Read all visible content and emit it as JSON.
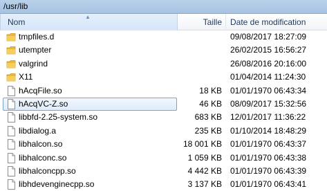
{
  "window": {
    "title": "/usr/lib"
  },
  "columns": {
    "name": "Nom",
    "size": "Taille",
    "date": "Date de modification"
  },
  "colors": {
    "folder": "#e8b83a",
    "selection_border": "#7da2ce",
    "header_text": "#1e395b"
  },
  "files": [
    {
      "name": "tmpfiles.d",
      "size": "",
      "date": "09/08/2017 18:27:09",
      "icon": "folder-icon",
      "selected": false
    },
    {
      "name": "utempter",
      "size": "",
      "date": "26/02/2015 16:56:27",
      "icon": "folder-icon",
      "selected": false
    },
    {
      "name": "valgrind",
      "size": "",
      "date": "26/08/2016 20:16:00",
      "icon": "folder-icon",
      "selected": false
    },
    {
      "name": "X11",
      "size": "",
      "date": "01/04/2014 11:24:30",
      "icon": "folder-icon",
      "selected": false
    },
    {
      "name": "hAcqFile.so",
      "size": "18 KB",
      "date": "01/01/1970 06:43:34",
      "icon": "file-icon",
      "selected": false
    },
    {
      "name": "hAcqVC-Z.so",
      "size": "46 KB",
      "date": "08/09/2017 15:32:56",
      "icon": "file-icon",
      "selected": true
    },
    {
      "name": "libbfd-2.25-system.so",
      "size": "683 KB",
      "date": "12/01/2017 11:36:22",
      "icon": "file-icon",
      "selected": false
    },
    {
      "name": "libdialog.a",
      "size": "235 KB",
      "date": "01/10/2014 18:48:29",
      "icon": "file-icon",
      "selected": false
    },
    {
      "name": "libhalcon.so",
      "size": "18 001 KB",
      "date": "01/01/1970 06:43:37",
      "icon": "file-icon",
      "selected": false
    },
    {
      "name": "libhalconc.so",
      "size": "1 059 KB",
      "date": "01/01/1970 06:43:38",
      "icon": "file-icon",
      "selected": false
    },
    {
      "name": "libhalconcpp.so",
      "size": "4 442 KB",
      "date": "01/01/1970 06:43:39",
      "icon": "file-icon",
      "selected": false
    },
    {
      "name": "libhdevenginecpp.so",
      "size": "3 137 KB",
      "date": "01/01/1970 06:43:41",
      "icon": "file-icon",
      "selected": false
    }
  ]
}
